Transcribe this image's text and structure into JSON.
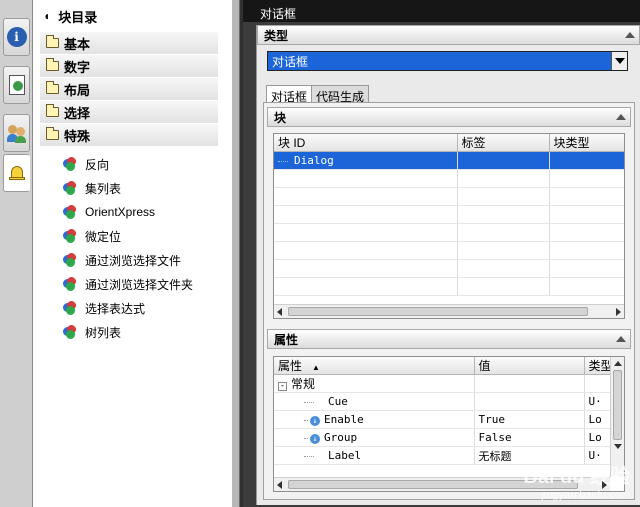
{
  "strip": {
    "buttons": [
      "info-icon",
      "document-globe-icon",
      "people-icon",
      "bell-icon"
    ]
  },
  "library": {
    "title": "块目录",
    "categories": [
      "基本",
      "数字",
      "布局",
      "选择",
      "特殊"
    ],
    "items": [
      "反向",
      "集列表",
      "OrientXpress",
      "微定位",
      "通过浏览选择文件",
      "通过浏览选择文件夹",
      "选择表达式",
      "树列表"
    ]
  },
  "dialog": {
    "title": "对话框",
    "type_section": "类型",
    "type_value": "对话框",
    "tabs": [
      "对话框",
      "代码生成"
    ],
    "block_section": "块",
    "block_table": {
      "headers": [
        "块 ID",
        "标签",
        "块类型"
      ],
      "rows": [
        [
          "Dialog",
          "",
          ""
        ]
      ]
    },
    "props_section": "属性",
    "props_table": {
      "headers": [
        "属性",
        "值",
        "类型"
      ],
      "group": "常规",
      "rows": [
        {
          "name": "Cue",
          "value": "",
          "type": "U·"
        },
        {
          "name": "Enable",
          "value": "True",
          "type": "Lo"
        },
        {
          "name": "Group",
          "value": "False",
          "type": "Lo"
        },
        {
          "name": "Label",
          "value": "无标题",
          "type": "U·"
        }
      ]
    }
  },
  "watermark": {
    "line1": "Bai du 经验",
    "line2": "jingyan.baidu.com"
  }
}
